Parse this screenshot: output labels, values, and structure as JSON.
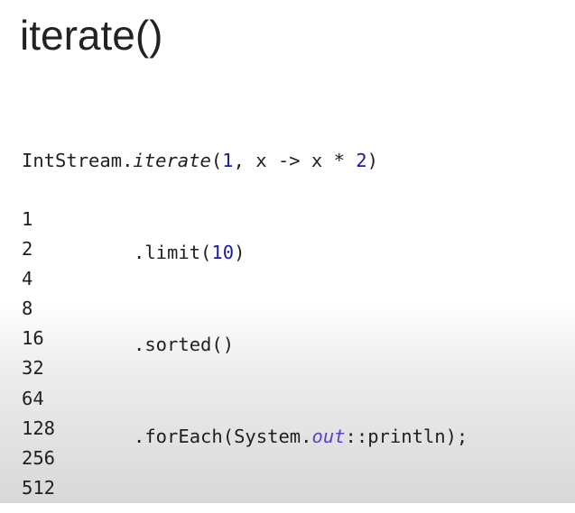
{
  "slide": {
    "title": "iterate()",
    "code": {
      "line1": {
        "cls": "IntStream.",
        "method": "iterate",
        "open": "(",
        "seed": "1",
        "mid": ", x -> x * ",
        "factor": "2",
        "close": ")"
      },
      "line2": {
        "pre": ".limit(",
        "num": "10",
        "post": ")"
      },
      "line3": {
        "text": ".sorted()"
      },
      "line4": {
        "pre": ".forEach(System.",
        "field": "out",
        "post": "::println);"
      }
    },
    "output": [
      "1",
      "2",
      "4",
      "8",
      "16",
      "32",
      "64",
      "128",
      "256",
      "512"
    ]
  }
}
